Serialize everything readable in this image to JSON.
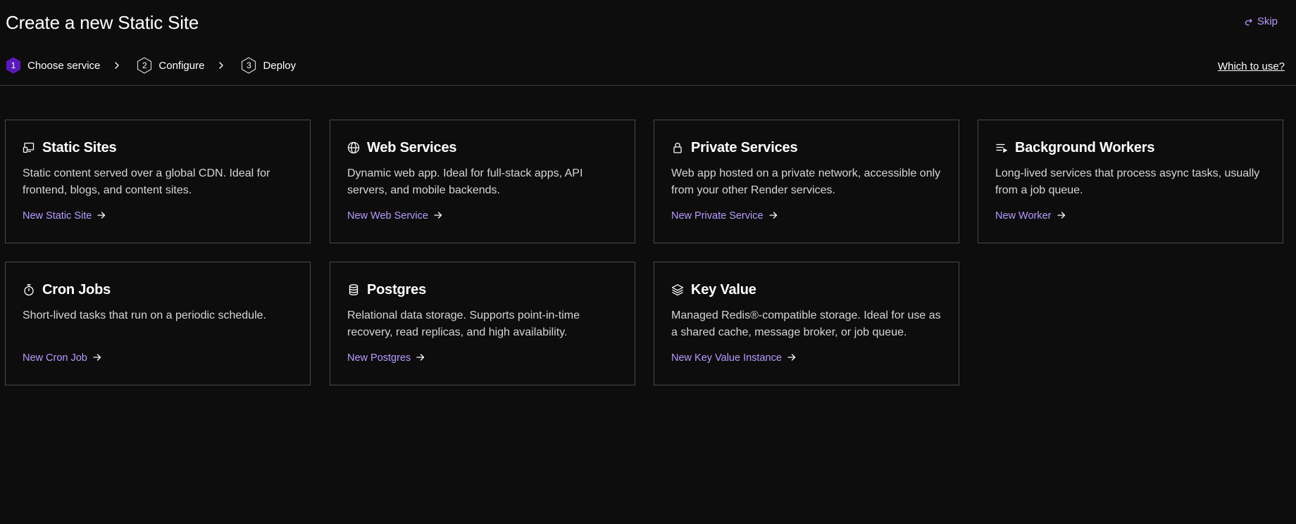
{
  "header": {
    "title": "Create a new Static Site",
    "skip_label": "Skip"
  },
  "stepper": {
    "steps": [
      {
        "number": "1",
        "label": "Choose service",
        "state": "active"
      },
      {
        "number": "2",
        "label": "Configure",
        "state": "inactive"
      },
      {
        "number": "3",
        "label": "Deploy",
        "state": "inactive"
      }
    ],
    "help_link": "Which to use?"
  },
  "cards": [
    {
      "icon": "static-site-icon",
      "title": "Static Sites",
      "description": "Static content served over a global CDN. Ideal for frontend, blogs, and content sites.",
      "link": "New Static Site"
    },
    {
      "icon": "globe-icon",
      "title": "Web Services",
      "description": "Dynamic web app. Ideal for full-stack apps, API servers, and mobile backends.",
      "link": "New Web Service"
    },
    {
      "icon": "lock-icon",
      "title": "Private Services",
      "description": "Web app hosted on a private network, accessible only from your other Render services.",
      "link": "New Private Service"
    },
    {
      "icon": "worker-queue-icon",
      "title": "Background Workers",
      "description": "Long-lived services that process async tasks, usually from a job queue.",
      "link": "New Worker"
    },
    {
      "icon": "stopwatch-icon",
      "title": "Cron Jobs",
      "description": "Short-lived tasks that run on a periodic schedule.",
      "link": "New Cron Job"
    },
    {
      "icon": "database-icon",
      "title": "Postgres",
      "description": "Relational data storage. Supports point-in-time recovery, read replicas, and high availability.",
      "link": "New Postgres"
    },
    {
      "icon": "layers-icon",
      "title": "Key Value",
      "description": "Managed Redis®-compatible storage. Ideal for use as a shared cache, message broker, or job queue.",
      "link": "New Key Value Instance"
    }
  ],
  "colors": {
    "background": "#0d0d0d",
    "accent": "#b79cff",
    "active_step": "#5b1ab8",
    "border": "#4a4a4a"
  }
}
